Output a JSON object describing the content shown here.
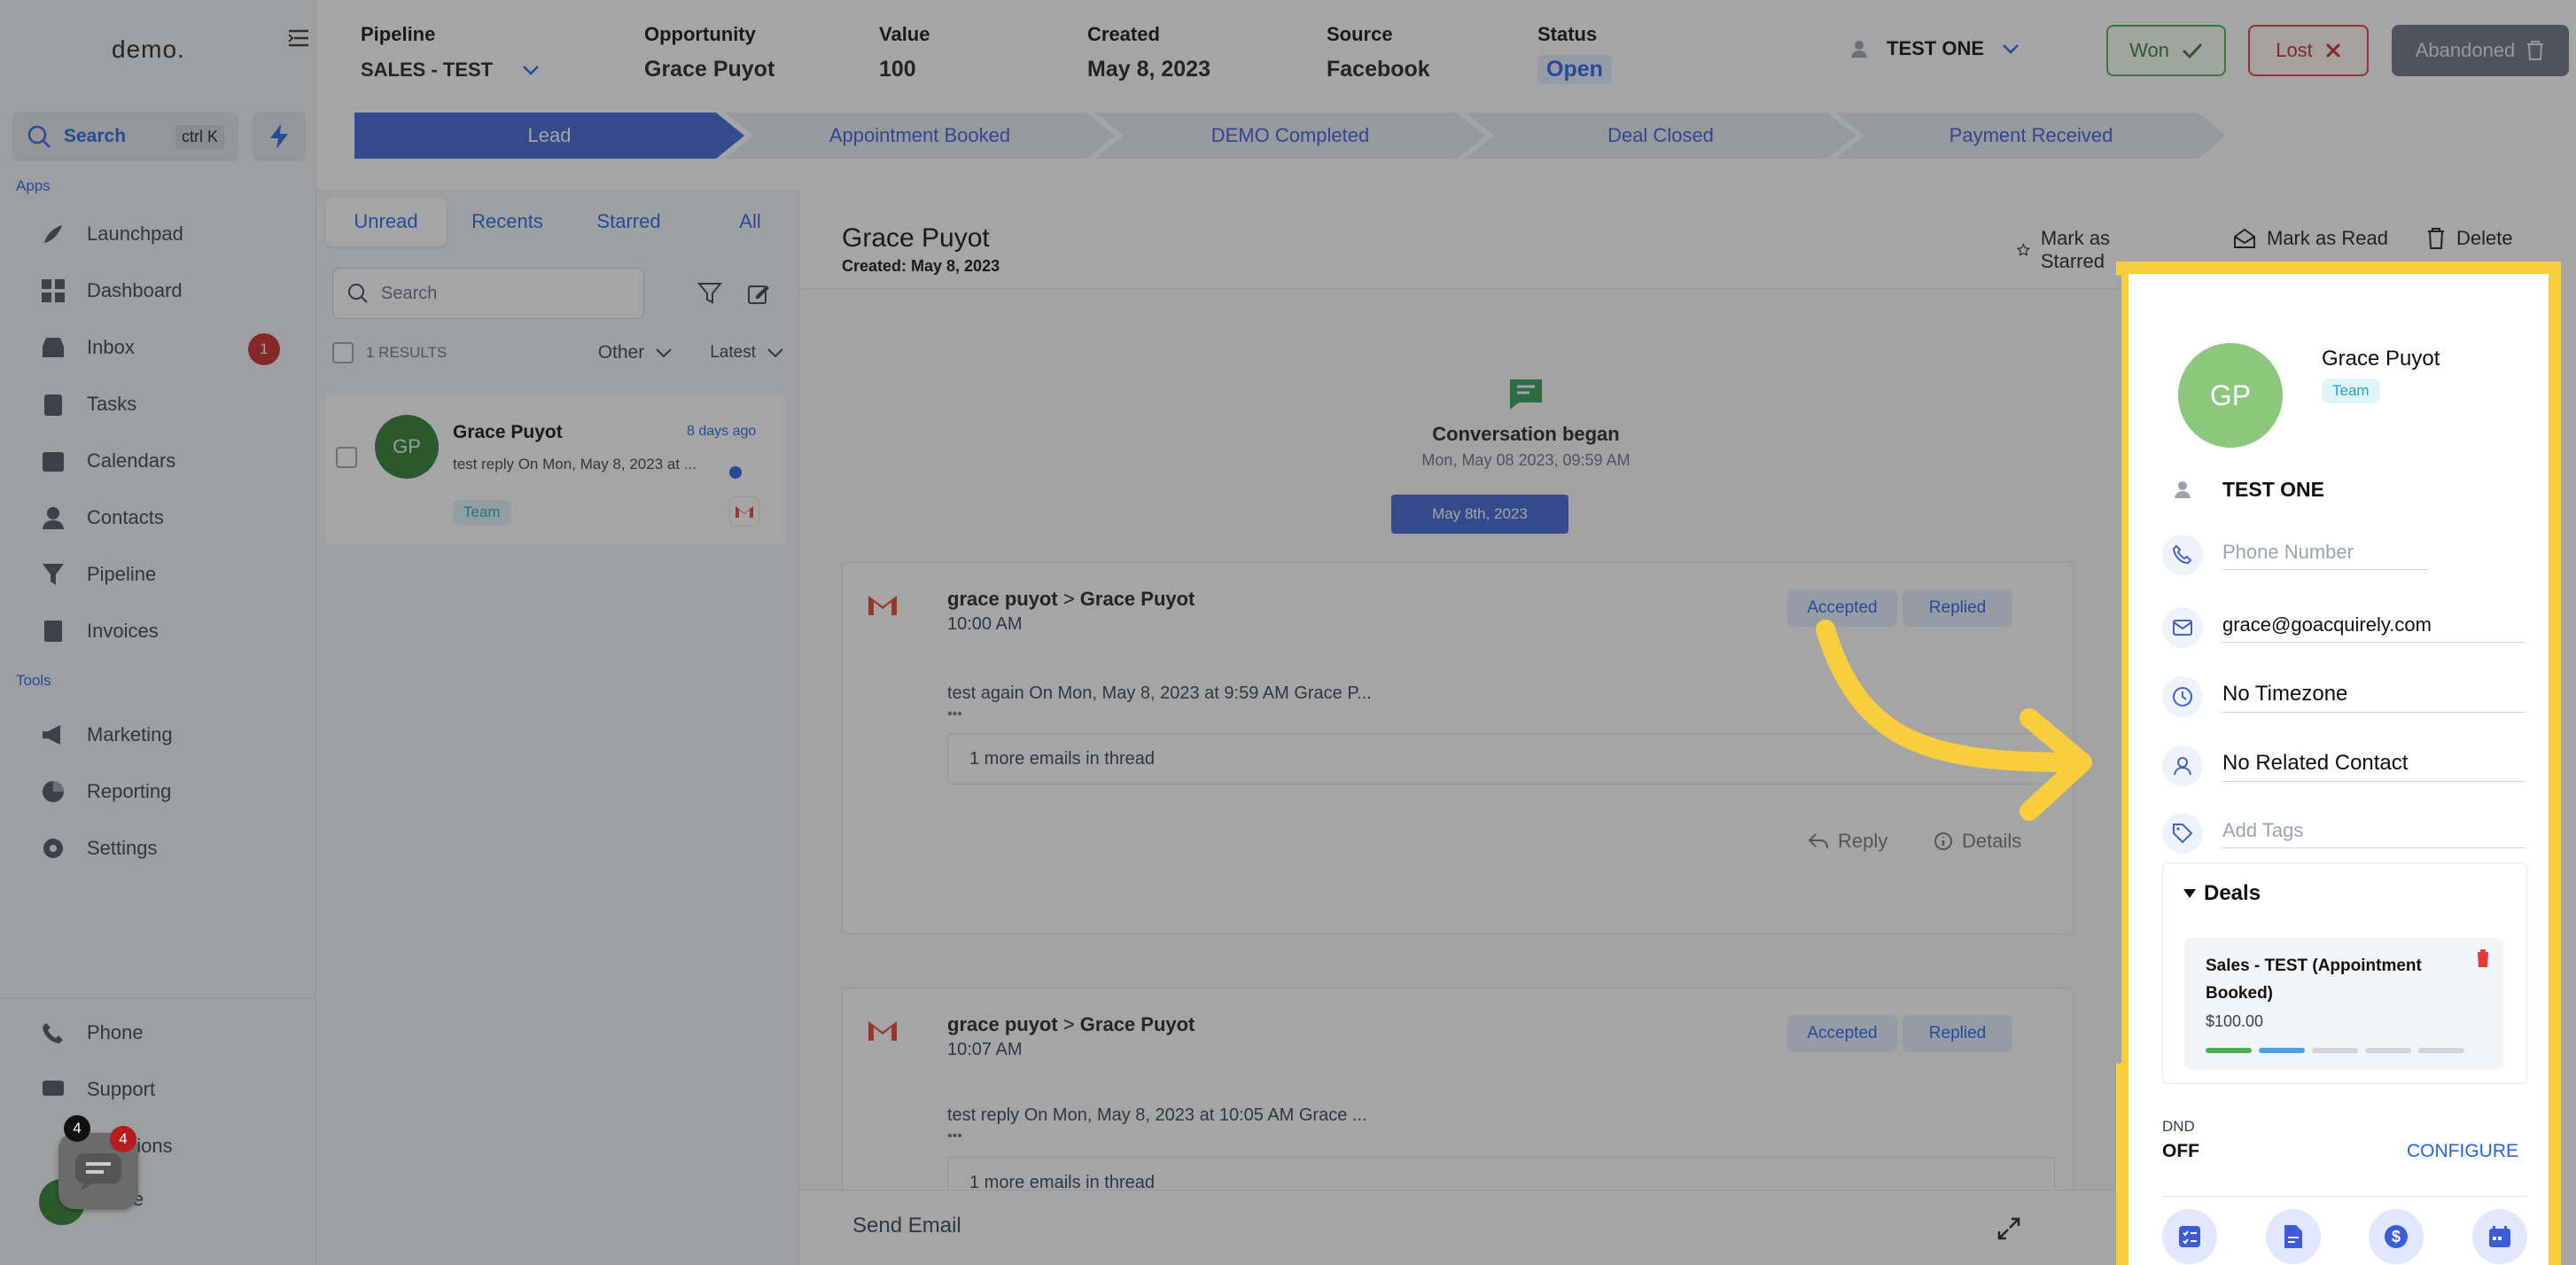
{
  "sidebar": {
    "logo": "demo.",
    "search_label": "Search",
    "search_shortcut": "ctrl K",
    "apps_label": "Apps",
    "apps": [
      {
        "label": "Launchpad",
        "icon": "rocket-icon"
      },
      {
        "label": "Dashboard",
        "icon": "dashboard-icon"
      },
      {
        "label": "Inbox",
        "icon": "inbox-icon",
        "badge": "1"
      },
      {
        "label": "Tasks",
        "icon": "tasks-icon"
      },
      {
        "label": "Calendars",
        "icon": "calendar-icon"
      },
      {
        "label": "Contacts",
        "icon": "contacts-icon"
      },
      {
        "label": "Pipeline",
        "icon": "pipeline-icon"
      },
      {
        "label": "Invoices",
        "icon": "invoices-icon"
      }
    ],
    "tools_label": "Tools",
    "tools": [
      {
        "label": "Marketing",
        "icon": "megaphone-icon"
      },
      {
        "label": "Reporting",
        "icon": "pie-chart-icon"
      },
      {
        "label": "Settings",
        "icon": "gear-icon"
      }
    ],
    "bottom": [
      {
        "label": "Phone",
        "icon": "phone-icon"
      },
      {
        "label": "Support",
        "icon": "support-icon"
      },
      {
        "label": "Notifications",
        "visible": "ications"
      },
      {
        "label": "Profile",
        "visible": "file"
      }
    ],
    "chat_badge_dark": "4",
    "chat_badge_red": "4"
  },
  "topbar": {
    "pipeline_label": "Pipeline",
    "pipeline_value": "SALES - TEST",
    "opportunity_label": "Opportunity",
    "opportunity_value": "Grace Puyot",
    "value_label": "Value",
    "value_value": "100",
    "created_label": "Created",
    "created_value": "May 8, 2023",
    "source_label": "Source",
    "source_value": "Facebook",
    "status_label": "Status",
    "status_value": "Open",
    "owner": "TEST ONE",
    "won_label": "Won",
    "lost_label": "Lost",
    "abandoned_label": "Abandoned"
  },
  "stages": [
    "Lead",
    "Appointment Booked",
    "DEMO Completed",
    "Deal Closed",
    "Payment Received"
  ],
  "convlist": {
    "tabs": [
      "Unread",
      "Recents",
      "Starred",
      "All"
    ],
    "search_placeholder": "Search",
    "results": "1 RESULTS",
    "filter_other": "Other",
    "filter_latest": "Latest",
    "card": {
      "initials": "GP",
      "name": "Grace Puyot",
      "time": "8 days ago",
      "preview": "test reply On Mon, May 8, 2023 at ...",
      "tag": "Team"
    }
  },
  "main": {
    "title": "Grace Puyot",
    "created": "Created: May 8, 2023",
    "mark_starred": "Mark as Starred",
    "mark_read": "Mark as Read",
    "delete": "Delete",
    "conv_began": "Conversation began",
    "conv_began_time": "Mon, May 08 2023, 09:59 AM",
    "date_pill": "May 8th, 2023",
    "emails": [
      {
        "from": "grace puyot",
        "to": "Grace Puyot",
        "time": "10:00 AM",
        "accepted": "Accepted",
        "replied": "Replied",
        "body": "test again On Mon, May 8, 2023 at 9:59 AM Grace P...",
        "dots": "•••",
        "more": "1 more emails in thread",
        "reply": "Reply",
        "details": "Details"
      },
      {
        "from": "grace puyot",
        "to": "Grace Puyot",
        "time": "10:07 AM",
        "accepted": "Accepted",
        "replied": "Replied",
        "body": "test reply On Mon, May 8, 2023 at 10:05 AM Grace ...",
        "dots": "•••",
        "more": "1 more emails in thread"
      }
    ],
    "send_email": "Send Email"
  },
  "contact_panel": {
    "initials": "GP",
    "name": "Grace Puyot",
    "tag": "Team",
    "owner": "TEST ONE",
    "phone_placeholder": "Phone Number",
    "email": "grace@goacquirely.com",
    "timezone": "No Timezone",
    "related": "No Related Contact",
    "tags_placeholder": "Add Tags",
    "deals_label": "Deals",
    "deal_title": "Sales - TEST (Appointment Booked)",
    "deal_amount": "$100.00",
    "deal_stage_progress": 0.4,
    "dnd_label": "DND",
    "dnd_value": "OFF",
    "configure": "CONFIGURE"
  },
  "colors": {
    "accent": "#2563eb",
    "highlight": "#f8ce3e",
    "won": "#2e7d32",
    "lost": "#c62828"
  }
}
